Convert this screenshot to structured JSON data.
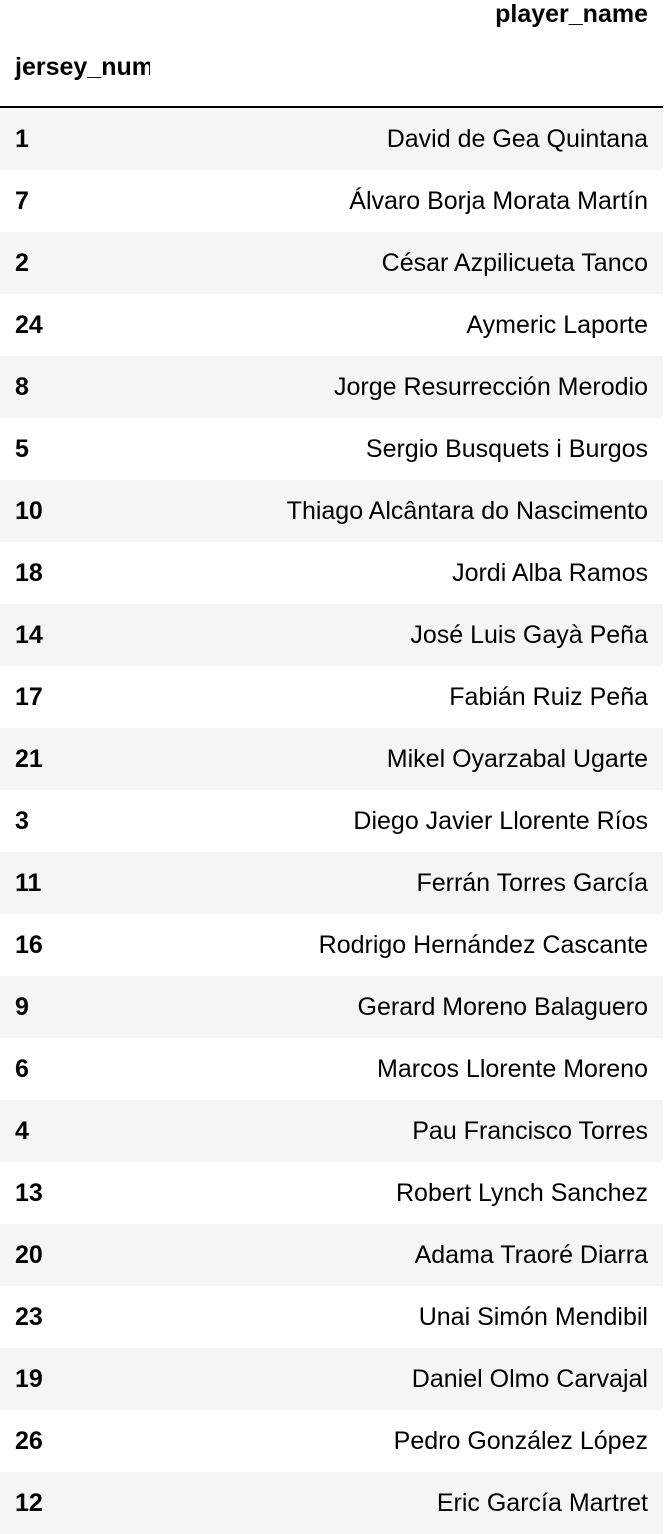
{
  "table": {
    "columns_header": "player_name",
    "index_name": "jersey_number",
    "rows": [
      {
        "jersey_number": "1",
        "player_name": "David de Gea Quintana"
      },
      {
        "jersey_number": "7",
        "player_name": "Álvaro Borja Morata Martín"
      },
      {
        "jersey_number": "2",
        "player_name": "César Azpilicueta Tanco"
      },
      {
        "jersey_number": "24",
        "player_name": "Aymeric Laporte"
      },
      {
        "jersey_number": "8",
        "player_name": "Jorge Resurrección Merodio"
      },
      {
        "jersey_number": "5",
        "player_name": "Sergio Busquets i Burgos"
      },
      {
        "jersey_number": "10",
        "player_name": "Thiago Alcântara do Nascimento"
      },
      {
        "jersey_number": "18",
        "player_name": "Jordi Alba Ramos"
      },
      {
        "jersey_number": "14",
        "player_name": "José Luis Gayà Peña"
      },
      {
        "jersey_number": "17",
        "player_name": "Fabián Ruiz Peña"
      },
      {
        "jersey_number": "21",
        "player_name": "Mikel Oyarzabal Ugarte"
      },
      {
        "jersey_number": "3",
        "player_name": "Diego Javier Llorente Ríos"
      },
      {
        "jersey_number": "11",
        "player_name": "Ferrán Torres García"
      },
      {
        "jersey_number": "16",
        "player_name": "Rodrigo Hernández Cascante"
      },
      {
        "jersey_number": "9",
        "player_name": "Gerard Moreno Balaguero"
      },
      {
        "jersey_number": "6",
        "player_name": "Marcos Llorente Moreno"
      },
      {
        "jersey_number": "4",
        "player_name": "Pau Francisco Torres"
      },
      {
        "jersey_number": "13",
        "player_name": "Robert Lynch Sanchez"
      },
      {
        "jersey_number": "20",
        "player_name": "Adama Traoré Diarra"
      },
      {
        "jersey_number": "23",
        "player_name": "Unai Simón Mendibil"
      },
      {
        "jersey_number": "19",
        "player_name": "Daniel Olmo Carvajal"
      },
      {
        "jersey_number": "26",
        "player_name": "Pedro González López"
      },
      {
        "jersey_number": "12",
        "player_name": "Eric García Martret"
      }
    ]
  },
  "colors": {
    "stripe": "#f5f5f5",
    "background": "#ffffff",
    "header_rule": "#000000",
    "text": "#000000"
  }
}
